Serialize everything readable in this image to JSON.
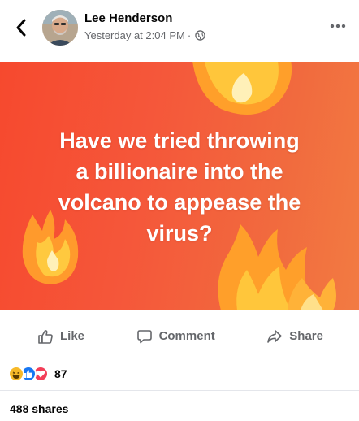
{
  "post": {
    "author": "Lee Henderson",
    "timestamp": "Yesterday at 2:04 PM",
    "separator": "·",
    "audience_icon": "globe-icon",
    "text": "Have we tried throwing\na billionaire into the\nvolcano to appease the\nvirus?"
  },
  "actions": {
    "like_label": "Like",
    "comment_label": "Comment",
    "share_label": "Share"
  },
  "reactions": {
    "types": [
      "haha",
      "like",
      "love"
    ],
    "count": "87"
  },
  "shares_label": "488 shares",
  "colors": {
    "background_start": "#f6492e",
    "background_end": "#f27b42",
    "text_secondary": "#65676b",
    "like_blue": "#1877f2",
    "love_red": "#f33e58",
    "haha_yellow": "#f7b928"
  }
}
